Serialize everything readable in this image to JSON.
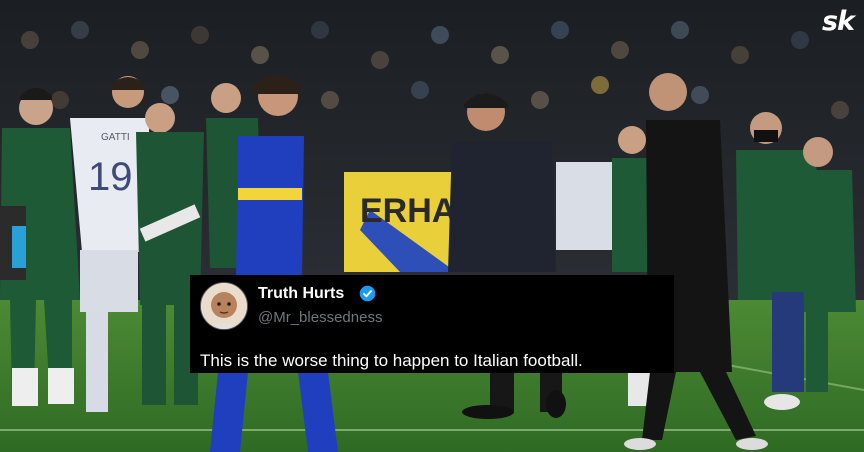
{
  "logo": {
    "text": "sk",
    "color": "#ffffff"
  },
  "banner": {
    "text": "ERHAO"
  },
  "players": {
    "white_jersey_name": "GATTI",
    "white_jersey_number": "19"
  },
  "tweet": {
    "display_name": "Truth Hurts",
    "handle": "@Mr_blessedness",
    "body": "This is the worse thing to happen to Italian football.",
    "avatar_icon": "avatar-icon",
    "verified_icon": "verified-badge-icon",
    "verified_color": "#1d9bf0",
    "background": "#000000"
  },
  "colors": {
    "italy_green": "#1f5a36",
    "bosnia_blue": "#1f3fbf",
    "bosnia_yellow": "#f2d53a",
    "pitch": "#3f7a2e"
  }
}
